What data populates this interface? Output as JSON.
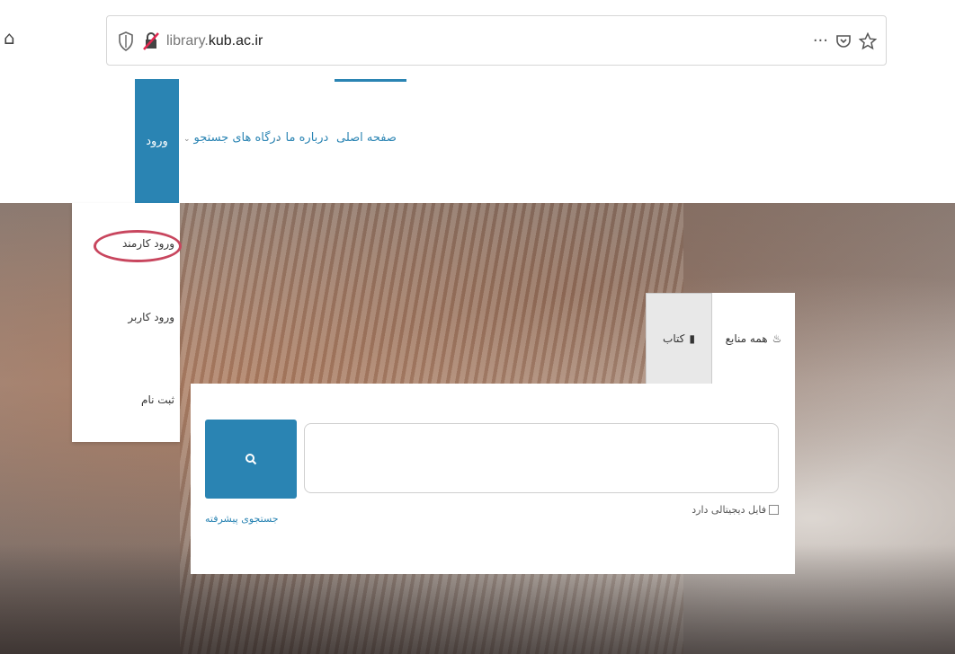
{
  "browser": {
    "url_prefix": "library.",
    "url_domain": "kub.ac.ir",
    "more_label": "···"
  },
  "nav": {
    "login": "ورود",
    "search_portals": "درگاه های جستجو",
    "about": "درباره ما",
    "home": "صفحه اصلی",
    "accent_color": "#2a84b3"
  },
  "login_menu": {
    "items": [
      "ورود کارمند",
      "ورود کاربر",
      "ثبت نام"
    ],
    "highlight_color": "#c8465e"
  },
  "search": {
    "tab_all": "همه منابع",
    "tab_books": "کتاب",
    "advanced_link": "جستجوی پیشرفته",
    "digital_file_checkbox": "فایل دیجیتالی دارد",
    "query_value": ""
  }
}
